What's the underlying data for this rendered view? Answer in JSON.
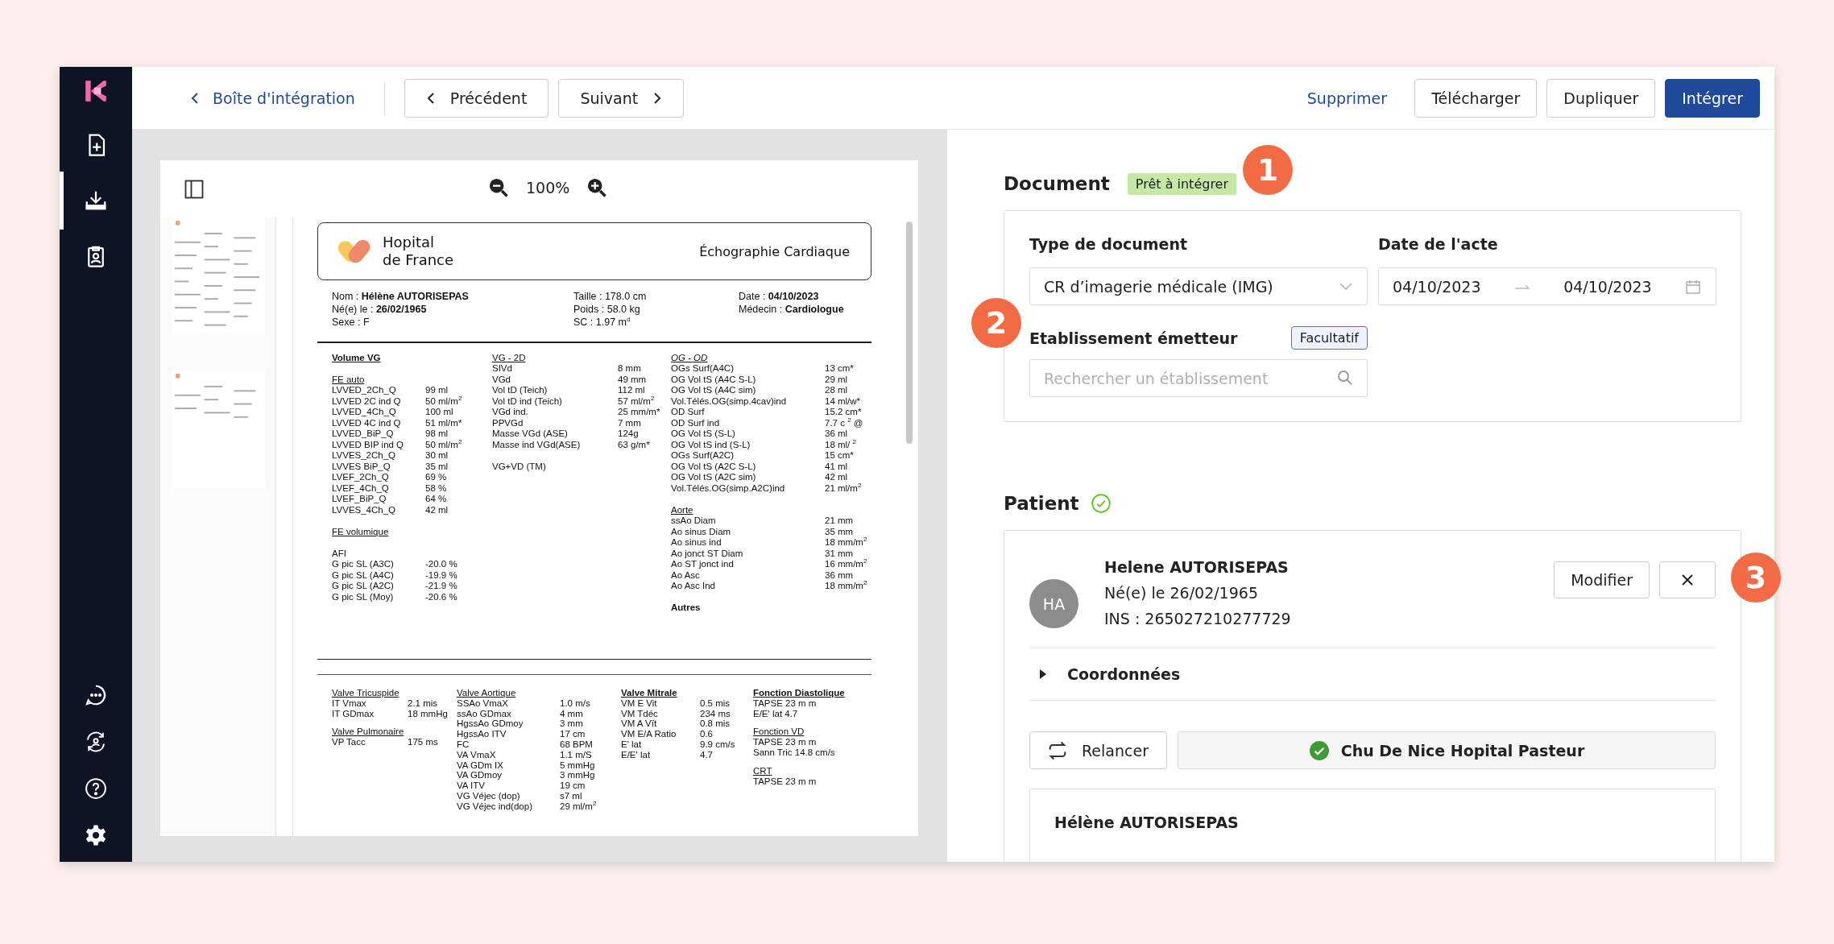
{
  "sidebar": {
    "items": [
      {
        "selected": false
      },
      {
        "selected": true
      },
      {
        "selected": false
      }
    ]
  },
  "topbar": {
    "back_link": "Boîte d'intégration",
    "previous": "Précédent",
    "next": "Suivant",
    "actions": [
      {
        "label": "Supprimer",
        "kind": "link"
      },
      {
        "label": "Télécharger",
        "kind": "secondary"
      },
      {
        "label": "Dupliquer",
        "kind": "secondary"
      },
      {
        "label": "Intégrer",
        "kind": "primary"
      }
    ]
  },
  "viewer": {
    "zoom": "100%"
  },
  "report": {
    "hospital": "Hopital de France",
    "title": "Échographie Cardiaque",
    "info_columns": [
      [
        "Nom : **Hélène AUTORISEPAS**",
        "Né(e) le : **26/02/1965**",
        "Sexe : F"
      ],
      [
        "Taille : 178.0 cm",
        "Poids : 58.0 kg",
        "SC : 1.97 m$^{d}$"
      ],
      [
        "Date : **04/10/2023**",
        "Médecin : **Cardiologue**"
      ]
    ],
    "upper_columns": [
      [
        {
          "heading": "Volume VG",
          "kind": "bold-underline"
        },
        {
          "heading": "FE auto",
          "kind": "underline",
          "rows": [
            {
              "label": "LVVED_2Ch_Q",
              "value": "99 ml"
            },
            {
              "label": "LVVED 2C ind Q",
              "value": "50 ml/m$^{2}$"
            },
            {
              "label": "LVVED_4Ch_Q",
              "value": "100 ml"
            },
            {
              "label": "LVVED 4C ind Q",
              "value": "51 ml/m*"
            },
            {
              "label": "LVVED_BiP_Q",
              "value": "98 ml"
            },
            {
              "label": "LVVED BIP ind Q",
              "value": "50 ml/m$^{2}$"
            },
            {
              "label": "LVVES_2Ch_Q",
              "value": "30 ml"
            },
            {
              "label": "LVVES BiP_Q",
              "value": "35 ml"
            },
            {
              "label": "LVEF_2Ch_Q",
              "value": "69 %"
            },
            {
              "label": "LVEF_4Ch_Q",
              "value": "58 %"
            },
            {
              "label": "LVEF_BiP_Q",
              "value": "64 %"
            },
            {
              "label": "LVVES_4Ch_Q",
              "value": "42 ml"
            }
          ]
        },
        {
          "heading": "FE volumique",
          "kind": "underline"
        },
        {
          "rows": [
            {
              "label": "AFI"
            },
            {
              "label": "G pic SL (A3C)",
              "value": "-20.0 %"
            },
            {
              "label": "G pic SL (A4C)",
              "value": "-19.9 %"
            },
            {
              "label": "G pic SL (A2C)",
              "value": "-21.9 %"
            },
            {
              "label": "G pic SL (Moy)",
              "value": "-20.6 %"
            }
          ]
        }
      ],
      [
        {
          "heading": "VG - 2D",
          "kind": "underline",
          "rows": [
            {
              "label": "SIVd",
              "value": "8 mm"
            },
            {
              "label": "VGd",
              "value": "49 mm"
            },
            {
              "label": "Vol tD (Teich)",
              "value": "112 ml"
            },
            {
              "label": "Vol tD ind (Teich)",
              "value": "57 ml/m$^{2}$"
            },
            {
              "label": "VGd ind.",
              "value": "25 mm/m*"
            },
            {
              "label": "PPVGd",
              "value": "7 mm"
            },
            {
              "label": "Masse VGd (ASE)",
              "value": "124g"
            },
            {
              "label": "Masse ind VGd(ASE)",
              "value": "63 g/m*"
            }
          ]
        },
        {
          "rows": [
            {
              "label": "VG+VD (TM)"
            }
          ]
        }
      ],
      [
        {
          "heading": "OG - OD",
          "kind": "italic-underline",
          "rows": [
            {
              "label": "OGs Surf(A4C)",
              "value": "13 cm*"
            },
            {
              "label": "OG Vol tS (A4C S-L)",
              "value": "29 ml"
            },
            {
              "label": "OG Vol tS (A4C sim)",
              "value": "28 ml"
            },
            {
              "label": "Vol.Télés.OG(simp.4cav)ind",
              "value": "14 ml/w*"
            },
            {
              "label": "OD Surf",
              "value": "15.2 cm*"
            },
            {
              "label": "OD Surf ind",
              "value": "7.7 c $^{2}$ @"
            },
            {
              "label": "OG Vol tS (S-L)",
              "value": "36 ml"
            },
            {
              "label": "OG Vol tS ind (S-L)",
              "value": "18 ml/ $^{2}$"
            },
            {
              "label": "OGs Surf(A2C)",
              "value": "15 cm*"
            },
            {
              "label": "OG Vol tS (A2C S-L)",
              "value": "41 ml"
            },
            {
              "label": "OG Vol tS (A2C sim)",
              "value": "42 ml"
            },
            {
              "label": "Vol.Télés.OG(simp.A2C)ind",
              "value": "21 ml/m$^{2}$"
            }
          ]
        },
        {
          "heading": "Aorte",
          "kind": "underline",
          "rows": [
            {
              "label": "ssAo Diam",
              "value": "21 mm"
            },
            {
              "label": "Ao sinus Diam",
              "value": "35 mm"
            },
            {
              "label": "Ao sinus ind",
              "value": "18 mm/m$^{2}$"
            },
            {
              "label": "Ao jonct ST Diam",
              "value": "31 mm"
            },
            {
              "label": "Ao ST jonct ind",
              "value": "16 mm/m$^{2}$"
            },
            {
              "label": "Ao Asc",
              "value": "36 mm"
            },
            {
              "label": "Ao Asc Ind",
              "value": "18 mm/m$^{2}$"
            }
          ]
        },
        {
          "heading": "Autres",
          "kind": "bold"
        }
      ]
    ],
    "lower_columns": [
      [
        {
          "heading": "Valve Tricuspide",
          "kind": "underline",
          "rows": [
            {
              "label": "IT Vmax",
              "value": "2.1 mis"
            },
            {
              "label": "IT GDmax",
              "value": "18 mmHg"
            }
          ]
        },
        {
          "heading": "Valve Pulmonaire",
          "kind": "underline",
          "rows": [
            {
              "label": "VP Tacc",
              "value": "175 ms"
            }
          ]
        }
      ],
      [
        {
          "heading": "Valve Aortique",
          "kind": "underline",
          "rows": [
            {
              "label": "SSAo VmaX",
              "value": "1.0 m/s"
            },
            {
              "label": "ssAo GDmax",
              "value": "4 mm"
            },
            {
              "label": "HgssAo GDmoy",
              "value": "3 mm"
            },
            {
              "label": "HgssAo ITV",
              "value": "17 cm"
            },
            {
              "label": "FC",
              "value": "68 BPM"
            },
            {
              "label": "VA VmaX",
              "value": "1.1 m/S"
            },
            {
              "label": "VA GDm IX",
              "value": "5 mmHg"
            },
            {
              "label": "VA GDmoy",
              "value": "3 mmHg"
            },
            {
              "label": "VA ITV",
              "value": "19 cm"
            },
            {
              "label": "VG Véjec (dop)",
              "value": "s7 ml"
            },
            {
              "label": "VG Véjec ind(dop)",
              "value": "29 ml/m$^{2}$"
            }
          ]
        }
      ],
      [
        {
          "heading": "Valve Mitrale",
          "kind": "bold-underline",
          "rows": [
            {
              "label": "VM E Vit",
              "value": "0.5 mis"
            },
            {
              "label": "VM Tdéc",
              "value": "234 ms"
            },
            {
              "label": "VM A Vït",
              "value": "0.8 mis"
            },
            {
              "label": "VM E/A Ratio",
              "value": "0.6"
            },
            {
              "label": "E' lat",
              "value": "9.9 cm/s"
            },
            {
              "label": "E/E' lat",
              "value": "4.7"
            }
          ]
        }
      ],
      [
        {
          "heading": "Fonction Diastolique",
          "kind": "bold-underline",
          "rows": [
            {
              "label": "TAPSE 23 m m"
            },
            {
              "label": "E/E' lat 4.7"
            }
          ]
        },
        {
          "heading": "Fonction VD",
          "kind": "underline",
          "rows": [
            {
              "label": "TAPSE 23 m m"
            },
            {
              "label": "Sann Tric 14.8 cm/s"
            }
          ]
        },
        {
          "heading": "CRT",
          "kind": "underline",
          "rows": [
            {
              "label": "TAPSE 23 m m"
            }
          ]
        }
      ]
    ]
  },
  "details": {
    "document": {
      "title": "Document",
      "status": "Prêt à intégrer",
      "type_label": "Type de document",
      "type_value": "CR d’imagerie médicale (IMG)",
      "date_label": "Date de l'acte",
      "date_from": "04/10/2023",
      "date_to": "04/10/2023",
      "issuer_label": "Etablissement émetteur",
      "issuer_tag": "Facultatif",
      "issuer_placeholder": "Rechercher un établissement"
    },
    "patient": {
      "title": "Patient",
      "initials": "HA",
      "name": "Helene AUTORISEPAS",
      "birth": "Né(e) le 26/02/1965",
      "ins": "INS : 265027210277729",
      "edit": "Modifier",
      "contact_label": "Coordonnées",
      "contact_expanded": false,
      "retry": "Relancer",
      "match": "Chu De Nice Hopital Pasteur",
      "record_name": "Hélène AUTORISEPAS"
    }
  },
  "callouts": [
    "1",
    "2",
    "3"
  ]
}
